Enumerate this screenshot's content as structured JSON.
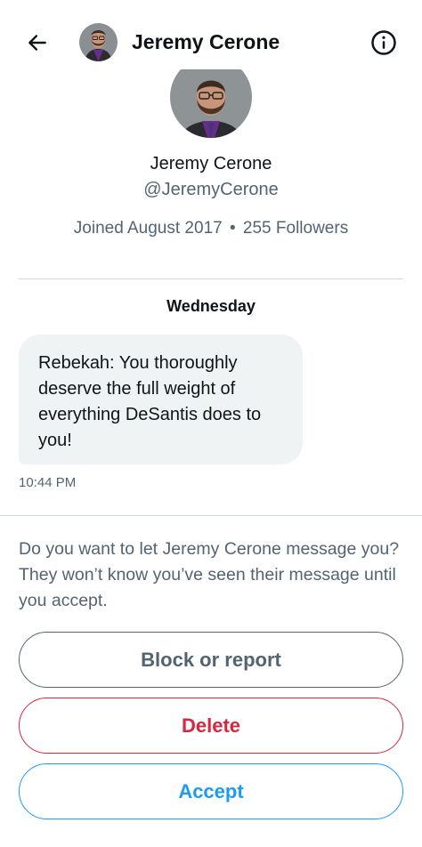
{
  "header": {
    "back_icon": "arrow-left-icon",
    "title": "Jeremy Cerone",
    "info_icon": "info-circle-icon"
  },
  "profile": {
    "name": "Jeremy Cerone",
    "handle": "@JeremyCerone",
    "joined": "Joined August 2017",
    "separator": "•",
    "followers": "255 Followers"
  },
  "conversation": {
    "day_label": "Wednesday",
    "messages": [
      {
        "text": "Rebekah: You thoroughly deserve the full weight of everything DeSantis does to you!",
        "time": "10:44 PM"
      }
    ]
  },
  "request": {
    "prompt": "Do you want to let Jeremy Cerone message you? They won’t know you’ve seen their message until you accept.",
    "block_label": "Block or report",
    "delete_label": "Delete",
    "accept_label": "Accept"
  },
  "colors": {
    "primary_text": "#0f1419",
    "secondary_text": "#536471",
    "bubble_bg": "#eff3f4",
    "danger": "#d7263d",
    "accent": "#1d9bf0",
    "divider": "#cfd9de"
  }
}
